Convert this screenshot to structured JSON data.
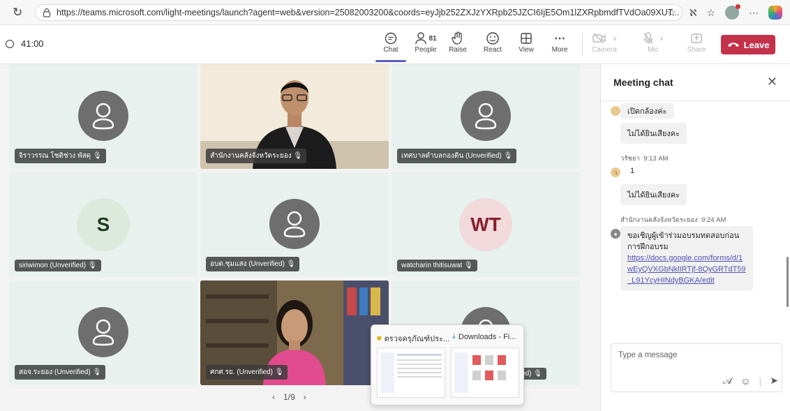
{
  "browser": {
    "url": "https://teams.microsoft.com/light-meetings/launch?agent=web&version=25082003200&coords=eyJjb252ZXJzYXRpb25JZCI6IjE5Om1lZXRpbmdfTVdOa09XUT..."
  },
  "meeting": {
    "timer": "41:00",
    "toolbar": {
      "chat": "Chat",
      "people": "People",
      "people_count": "81",
      "raise": "Raise",
      "react": "React",
      "view": "View",
      "more": "More",
      "camera": "Camera",
      "mic": "Mic",
      "share": "Share",
      "leave": "Leave"
    }
  },
  "tiles": [
    {
      "name": "จิราวรรณ โชติช่วง พัสดุ",
      "type": "avatar"
    },
    {
      "name": "สำนักงานคลังจังหวัดระยอง",
      "type": "video"
    },
    {
      "name": "เทศบาลตำบลกองดิน (Unverified)",
      "type": "avatar"
    },
    {
      "name": "siriwimon (Unverified)",
      "type": "initials",
      "initials": "S",
      "bg": "#dce9dc",
      "fg": "#1f3a22"
    },
    {
      "name": "อบต.ชุมแสง (Unverified)",
      "type": "avatar"
    },
    {
      "name": "watcharin thitisuwat",
      "type": "initials",
      "initials": "WT",
      "bg": "#f1d9dc",
      "fg": "#8a1f2c"
    },
    {
      "name": "สอจ.ระยอง (Unverified)",
      "type": "avatar"
    },
    {
      "name": "ศกศ.รย. (Unverified)",
      "type": "video"
    },
    {
      "name": "(Unverified)",
      "type": "avatar"
    }
  ],
  "pager": {
    "prev": "‹",
    "label": "1/9",
    "next": "›"
  },
  "taskbar_preview": {
    "item1": "ตรวจครุภัณฑ์ประ...",
    "item2": "Downloads - Fi..."
  },
  "chat": {
    "title": "Meeting chat",
    "messages": [
      {
        "text": "เปิดกล้องค่ะ"
      },
      {
        "text": "ไม่ได้ยินเสียงคะ"
      },
      {
        "sender": "วรัชยา",
        "time": "9:13 AM",
        "text": "1"
      },
      {
        "text": "ไม่ได้ยินเสียงคะ"
      },
      {
        "sender": "สำนักงานคลังจังหวัดระยอง",
        "time": "9:24 AM",
        "text": "ขอเชิญผู้เข้าร่วมอบรมทดสอบก่อนการฝึกอบรม",
        "link": "https://docs.google.com/forms/d/1wEyQVXGbNklIRTjf-8QyGRTdT59_L91YcyHINdyBGKA/edit"
      }
    ],
    "compose_placeholder": "Type a message"
  },
  "colors": {
    "leave": "#c4314b",
    "accent": "#5b5fc7",
    "tile_bg": "#e8f1ee",
    "avatar": "#6e6e6e"
  }
}
